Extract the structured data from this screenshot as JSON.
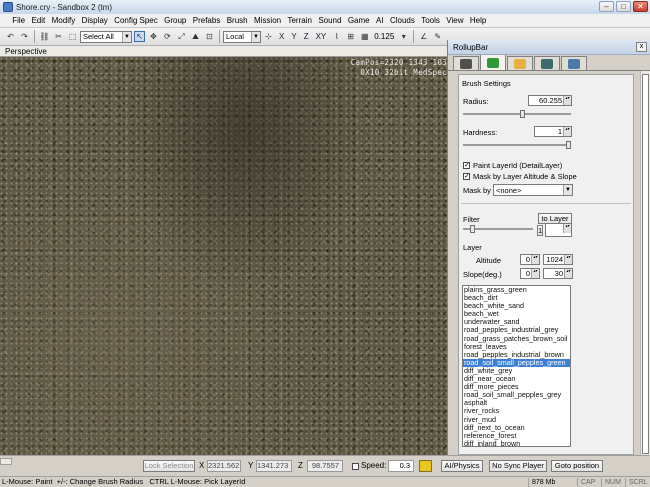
{
  "window": {
    "title": "Shore.cry - Sandbox 2 (tm)",
    "minimize": "–",
    "maximize": "□",
    "close": "✕"
  },
  "menu": [
    "File",
    "Edit",
    "Modify",
    "Display",
    "Config Spec",
    "Group",
    "Prefabs",
    "Brush",
    "Mission",
    "Terrain",
    "Sound",
    "Game",
    "AI",
    "Clouds",
    "Tools",
    "View",
    "Help"
  ],
  "toolbar": {
    "selection_filter": "Select All",
    "ref_coord": "Local",
    "axis_x": "X",
    "axis_y": "Y",
    "axis_z": "Z",
    "axis_xy": "XY",
    "grid_size": "0.125"
  },
  "viewport": {
    "label": "Perspective",
    "cam_line1": "CamPos=2320 1343 103",
    "cam_line2": "0X10 32bit MedSpec"
  },
  "rollup": {
    "title": "RollupBar",
    "close": "x",
    "brush_settings": "Brush Settings",
    "radius_label": "Radius:",
    "radius_value": "60.255",
    "radius_fraction": 0.55,
    "hardness_label": "Hardness:",
    "hardness_value": "1",
    "hardness_fraction": 1.0,
    "paint_layer_label": "Paint LayerId (DetailLayer)",
    "mask_altitude_label": "Mask by Layer Altitude & Slope",
    "mask_by_label": "Mask by",
    "mask_by_value": "<none>",
    "filter_label": "Filter",
    "to_layer_button": "to Layer",
    "filter_count": "1",
    "filter_fraction": 0.1,
    "layer_label": "Layer",
    "altitude_label": "Altitude",
    "altitude_min": "0",
    "altitude_max": "1024",
    "slope_label": "Slope(deg.)",
    "slope_min": "0",
    "slope_max": "30",
    "layers": [
      "plains_grass_green",
      "beach_dirt",
      "beach_white_sand",
      "beach_wet",
      "underwater_sand",
      "road_pepples_industrial_grey",
      "road_grass_patches_brown_soil",
      "forest_leaves",
      "road_pepples_industrial_brown",
      "road_soil_small_pepples_green",
      "diff_white_grey",
      "diff_near_ocean",
      "diff_more_pieces",
      "road_soil_small_pepples_grey",
      "asphalt",
      "river_rocks",
      "river_mud",
      "diff_next_to_ocean",
      "reference_forest",
      "diff_inland_brown"
    ],
    "selected_layer_index": 9
  },
  "bottom": {
    "lock_selection": "Lock Selection",
    "x_label": "X",
    "x_value": "2321.562",
    "y_label": "Y",
    "y_value": "1341.273",
    "z_label": "Z",
    "z_value": "98.7557",
    "speed_label": "Speed:",
    "speed_value": "0.3",
    "ai_physics": "AI/Physics",
    "no_sync": "No Sync Player",
    "goto_position": "Goto position"
  },
  "status": {
    "hint": "L-Mouse: Paint  +/-: Change Brush Radius   CTRL L-Mouse: Pick LayerId",
    "memory": "878 Mb",
    "cap": "CAP",
    "num": "NUM",
    "scrl": "SCRL"
  }
}
